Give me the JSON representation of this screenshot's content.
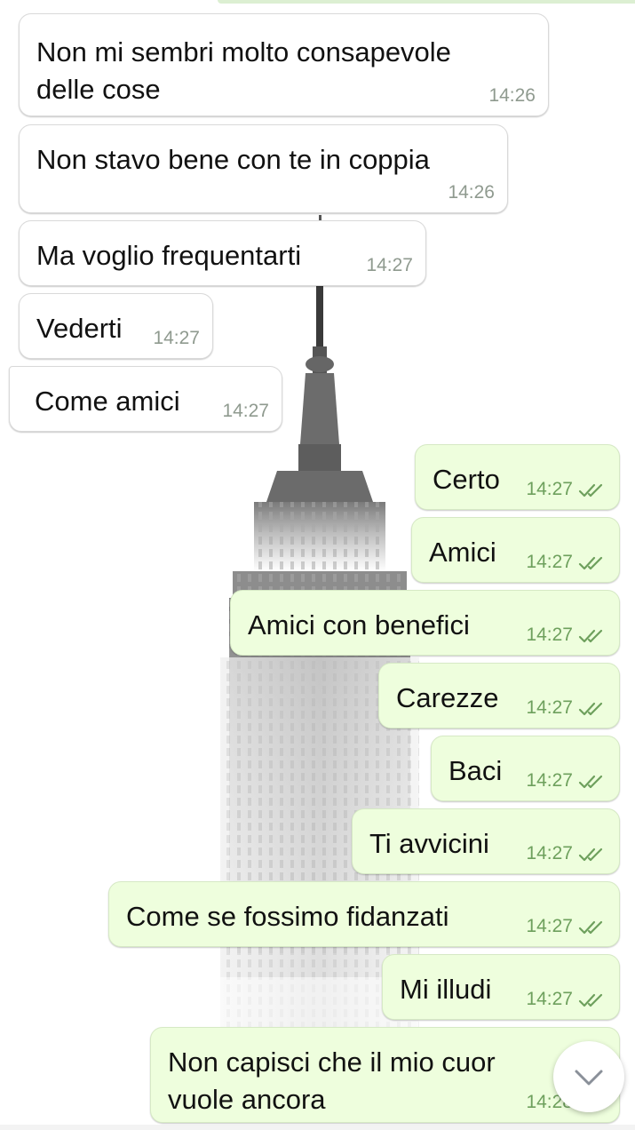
{
  "colors": {
    "incoming_bubble": "#ffffff",
    "outgoing_bubble": "#eefedd",
    "outgoing_time": "#6ea05d",
    "incoming_time": "#8f9a8f",
    "ticks": "#6ea05d"
  },
  "wallpaper": {
    "icon": "empire-state-building-icon"
  },
  "messages": [
    {
      "direction": "in",
      "text": "Non mi sembri molto consapevole\ndelle cose",
      "time": "14:26"
    },
    {
      "direction": "in",
      "text": "Non stavo bene con te in coppia",
      "time": "14:26"
    },
    {
      "direction": "in",
      "text": "Ma voglio frequentarti",
      "time": "14:27"
    },
    {
      "direction": "in",
      "text": "Vederti",
      "time": "14:27"
    },
    {
      "direction": "in",
      "text": "Come amici",
      "time": "14:27"
    },
    {
      "direction": "out",
      "text": "Certo",
      "time": "14:27",
      "status": "read-double-tick-icon"
    },
    {
      "direction": "out",
      "text": "Amici",
      "time": "14:27",
      "status": "read-double-tick-icon"
    },
    {
      "direction": "out",
      "text": "Amici con benefici",
      "time": "14:27",
      "status": "read-double-tick-icon"
    },
    {
      "direction": "out",
      "text": "Carezze",
      "time": "14:27",
      "status": "read-double-tick-icon"
    },
    {
      "direction": "out",
      "text": "Baci",
      "time": "14:27",
      "status": "read-double-tick-icon"
    },
    {
      "direction": "out",
      "text": "Ti avvicini",
      "time": "14:27",
      "status": "read-double-tick-icon"
    },
    {
      "direction": "out",
      "text": "Come se fossimo fidanzati",
      "time": "14:27",
      "status": "read-double-tick-icon"
    },
    {
      "direction": "out",
      "text": "Mi illudi",
      "time": "14:27",
      "status": "read-double-tick-icon"
    },
    {
      "direction": "out",
      "text": "Non capisci che il mio cuor\nvuole ancora",
      "time": "14:28",
      "status": "read-double-tick-icon"
    }
  ],
  "scroll_button": {
    "icon": "chevron-down-icon"
  }
}
